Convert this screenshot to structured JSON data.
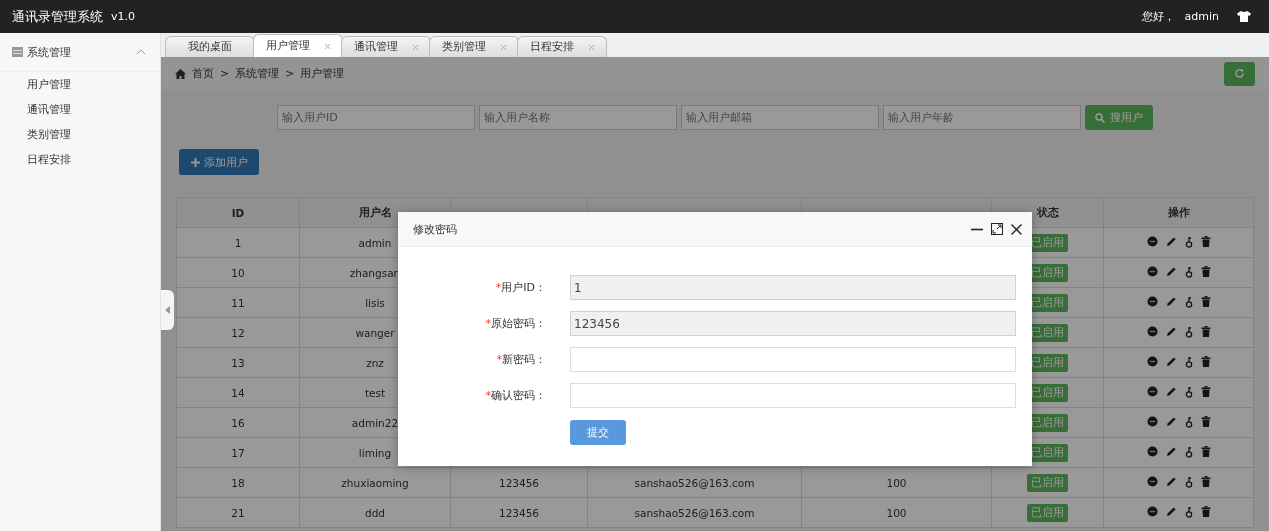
{
  "header": {
    "title": "通讯录管理系统",
    "version": "v1.0",
    "greeting": "您好，",
    "user": "admin"
  },
  "sidebar": {
    "group": {
      "label": "系统管理",
      "expanded": true,
      "children": [
        {
          "label": "用户管理"
        },
        {
          "label": "通讯管理"
        },
        {
          "label": "类别管理"
        },
        {
          "label": "日程安排"
        }
      ]
    }
  },
  "tabs": [
    {
      "label": "我的桌面",
      "selected": false,
      "closable": false
    },
    {
      "label": "用户管理",
      "selected": true,
      "closable": true
    },
    {
      "label": "通讯管理",
      "selected": false,
      "closable": true
    },
    {
      "label": "类别管理",
      "selected": false,
      "closable": true
    },
    {
      "label": "日程安排",
      "selected": false,
      "closable": true
    }
  ],
  "breadcrumb": [
    "首页",
    "系统管理",
    "用户管理"
  ],
  "breadcrumb_separators": [
    ">",
    ">"
  ],
  "search": {
    "fields": [
      {
        "placeholder": "输入用户ID"
      },
      {
        "placeholder": "输入用户名称"
      },
      {
        "placeholder": "输入用户邮箱"
      },
      {
        "placeholder": "输入用户年龄"
      }
    ],
    "button": "搜用户"
  },
  "add_button": "添加用户",
  "table": {
    "columns": [
      "ID",
      "用户名",
      "",
      "",
      "",
      "状态",
      "操作"
    ],
    "rows": [
      {
        "id": "1",
        "name": "admin",
        "status": "已启用"
      },
      {
        "id": "10",
        "name": "zhangsan",
        "status": "已启用"
      },
      {
        "id": "11",
        "name": "lisis",
        "status": "已启用"
      },
      {
        "id": "12",
        "name": "wanger",
        "status": "已启用"
      },
      {
        "id": "13",
        "name": "znz",
        "status": "已启用"
      },
      {
        "id": "14",
        "name": "test",
        "status": "已启用"
      },
      {
        "id": "16",
        "name": "admin22",
        "status": "已启用"
      },
      {
        "id": "17",
        "name": "liming",
        "status": "已启用"
      },
      {
        "id": "18",
        "name": "zhuxiaoming",
        "password": "123456",
        "email": "sanshao526@163.com",
        "age": "100",
        "status": "已启用"
      },
      {
        "id": "21",
        "name": "ddd",
        "password": "123456",
        "email": "sanshao526@163.com",
        "age": "100",
        "status": "已启用"
      }
    ]
  },
  "dialog": {
    "title": "修改密码",
    "fields": [
      {
        "required": "*",
        "label": "用户ID：",
        "value": "1",
        "disabled": true
      },
      {
        "required": "*",
        "label": "原始密码：",
        "value": "123456",
        "disabled": true
      },
      {
        "required": "*",
        "label": "新密码：",
        "disabled": false
      },
      {
        "required": "*",
        "label": "确认密码：",
        "disabled": false
      }
    ],
    "submit": "提交"
  }
}
